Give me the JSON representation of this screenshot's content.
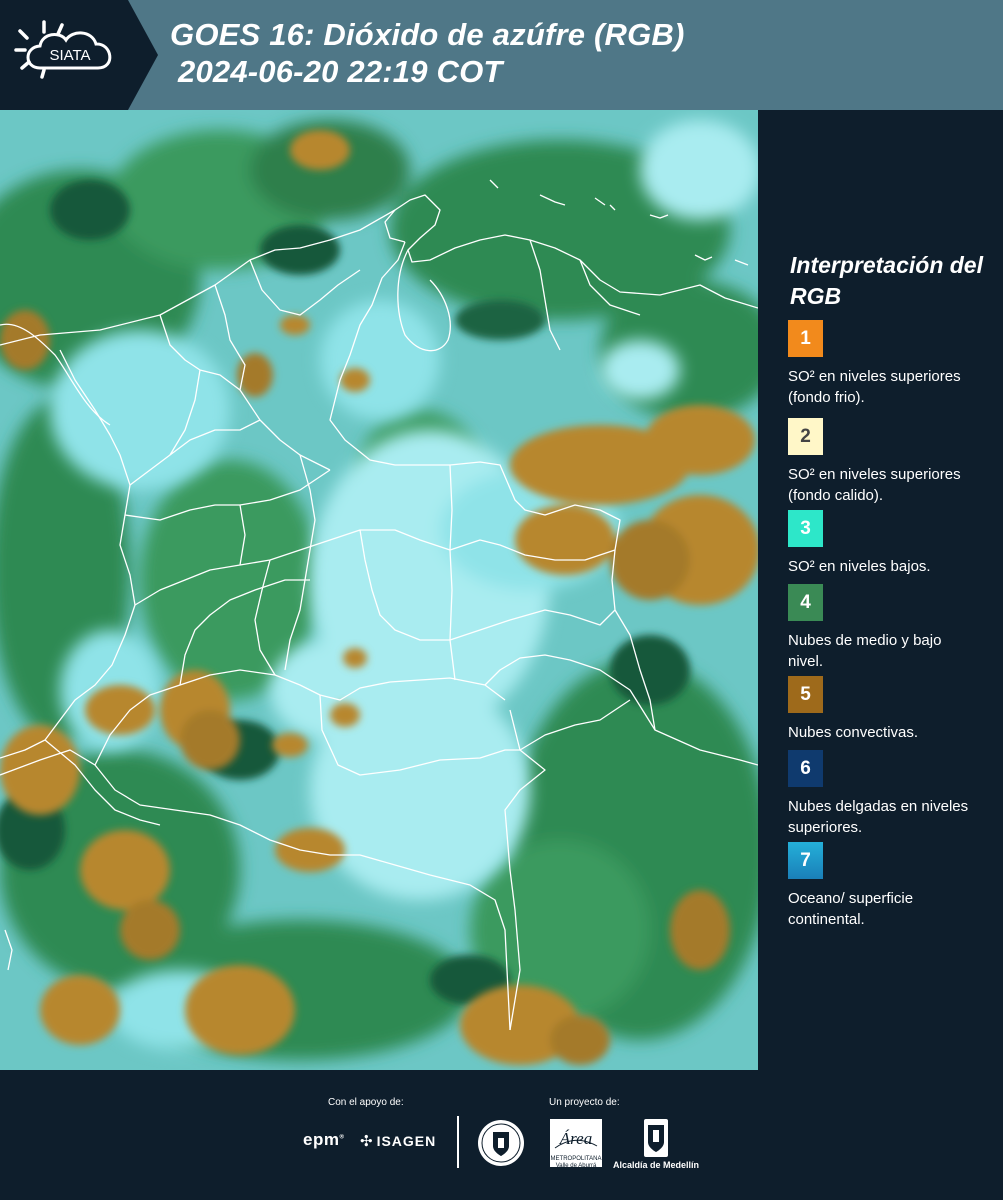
{
  "header": {
    "logo_text": "SIATA",
    "title_line1": "GOES 16: Dióxido de azúfre (RGB)",
    "title_line2": "2024-06-20 22:19 COT",
    "background": "#4f7787"
  },
  "map": {
    "colors": {
      "base": "#6cc7c5",
      "ocean_cyan": "#57d6df",
      "cloud_cyan": "#a9ecf0",
      "green": "#2f8a52",
      "dark_green": "#17583a",
      "convective": "#b7872e",
      "borders": "#ffffff"
    }
  },
  "legend": {
    "title": "Interpretación del RGB",
    "items": [
      {
        "number": "1",
        "color": "#f28a1c",
        "text_color": "#ffffff",
        "label": "SO² en niveles superiores (fondo frio)."
      },
      {
        "number": "2",
        "color": "#fff7c8",
        "text_color": "#444444",
        "label": "SO² en niveles superiores (fondo calido)."
      },
      {
        "number": "3",
        "color": "#2de7c9",
        "text_color": "#ffffff",
        "label": "SO² en niveles bajos."
      },
      {
        "number": "4",
        "color": "#3a8a55",
        "text_color": "#ffffff",
        "label": "Nubes de medio y bajo nivel."
      },
      {
        "number": "5",
        "color": "#9e6a1b",
        "text_color": "#ffffff",
        "label": "Nubes convectivas."
      },
      {
        "number": "6",
        "color": "#0f3a6e",
        "text_color": "#ffffff",
        "label": "Nubes delgadas en niveles superiores."
      },
      {
        "number": "7",
        "color": "#1c93c6",
        "text_color": "#ffffff",
        "label": "Oceano/ superficie continental."
      }
    ]
  },
  "footer": {
    "support_label": "Con el apoyo de:",
    "project_label": "Un proyecto de:",
    "epm_text": "epm",
    "isagen_text": "ISAGEN",
    "area_text": "Área",
    "area_caption": "METROPOLITANA Valle de Aburrá",
    "alcaldia_text": "Alcaldía de Medellín"
  }
}
